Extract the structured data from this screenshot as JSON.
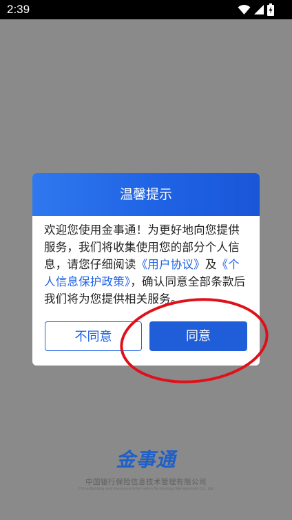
{
  "status_bar": {
    "time": "2:39"
  },
  "dialog": {
    "title": "温馨提示",
    "body_prefix": "欢迎您使用金事通！为更好地向您提供服务，我们将收集使用您的部分个人信息，请您仔细阅读",
    "link_user_agreement": "《用户协议》",
    "body_and": "及",
    "link_privacy_policy": "《个人信息保护政策》",
    "body_suffix": "，确认同意全部条款后我们将为您提供相关服务。",
    "disagree_label": "不同意",
    "agree_label": "同意"
  },
  "footer": {
    "brand": "金事通",
    "company_cn": "中国银行保险信息技术管理有限公司",
    "company_en": "China Banking and Insurance Information Technology Management Co., Ltd"
  },
  "colors": {
    "accent": "#1f63e4",
    "annotation": "#e0101a"
  },
  "icons": [
    "wifi-icon",
    "signal-icon",
    "battery-charging-icon"
  ]
}
